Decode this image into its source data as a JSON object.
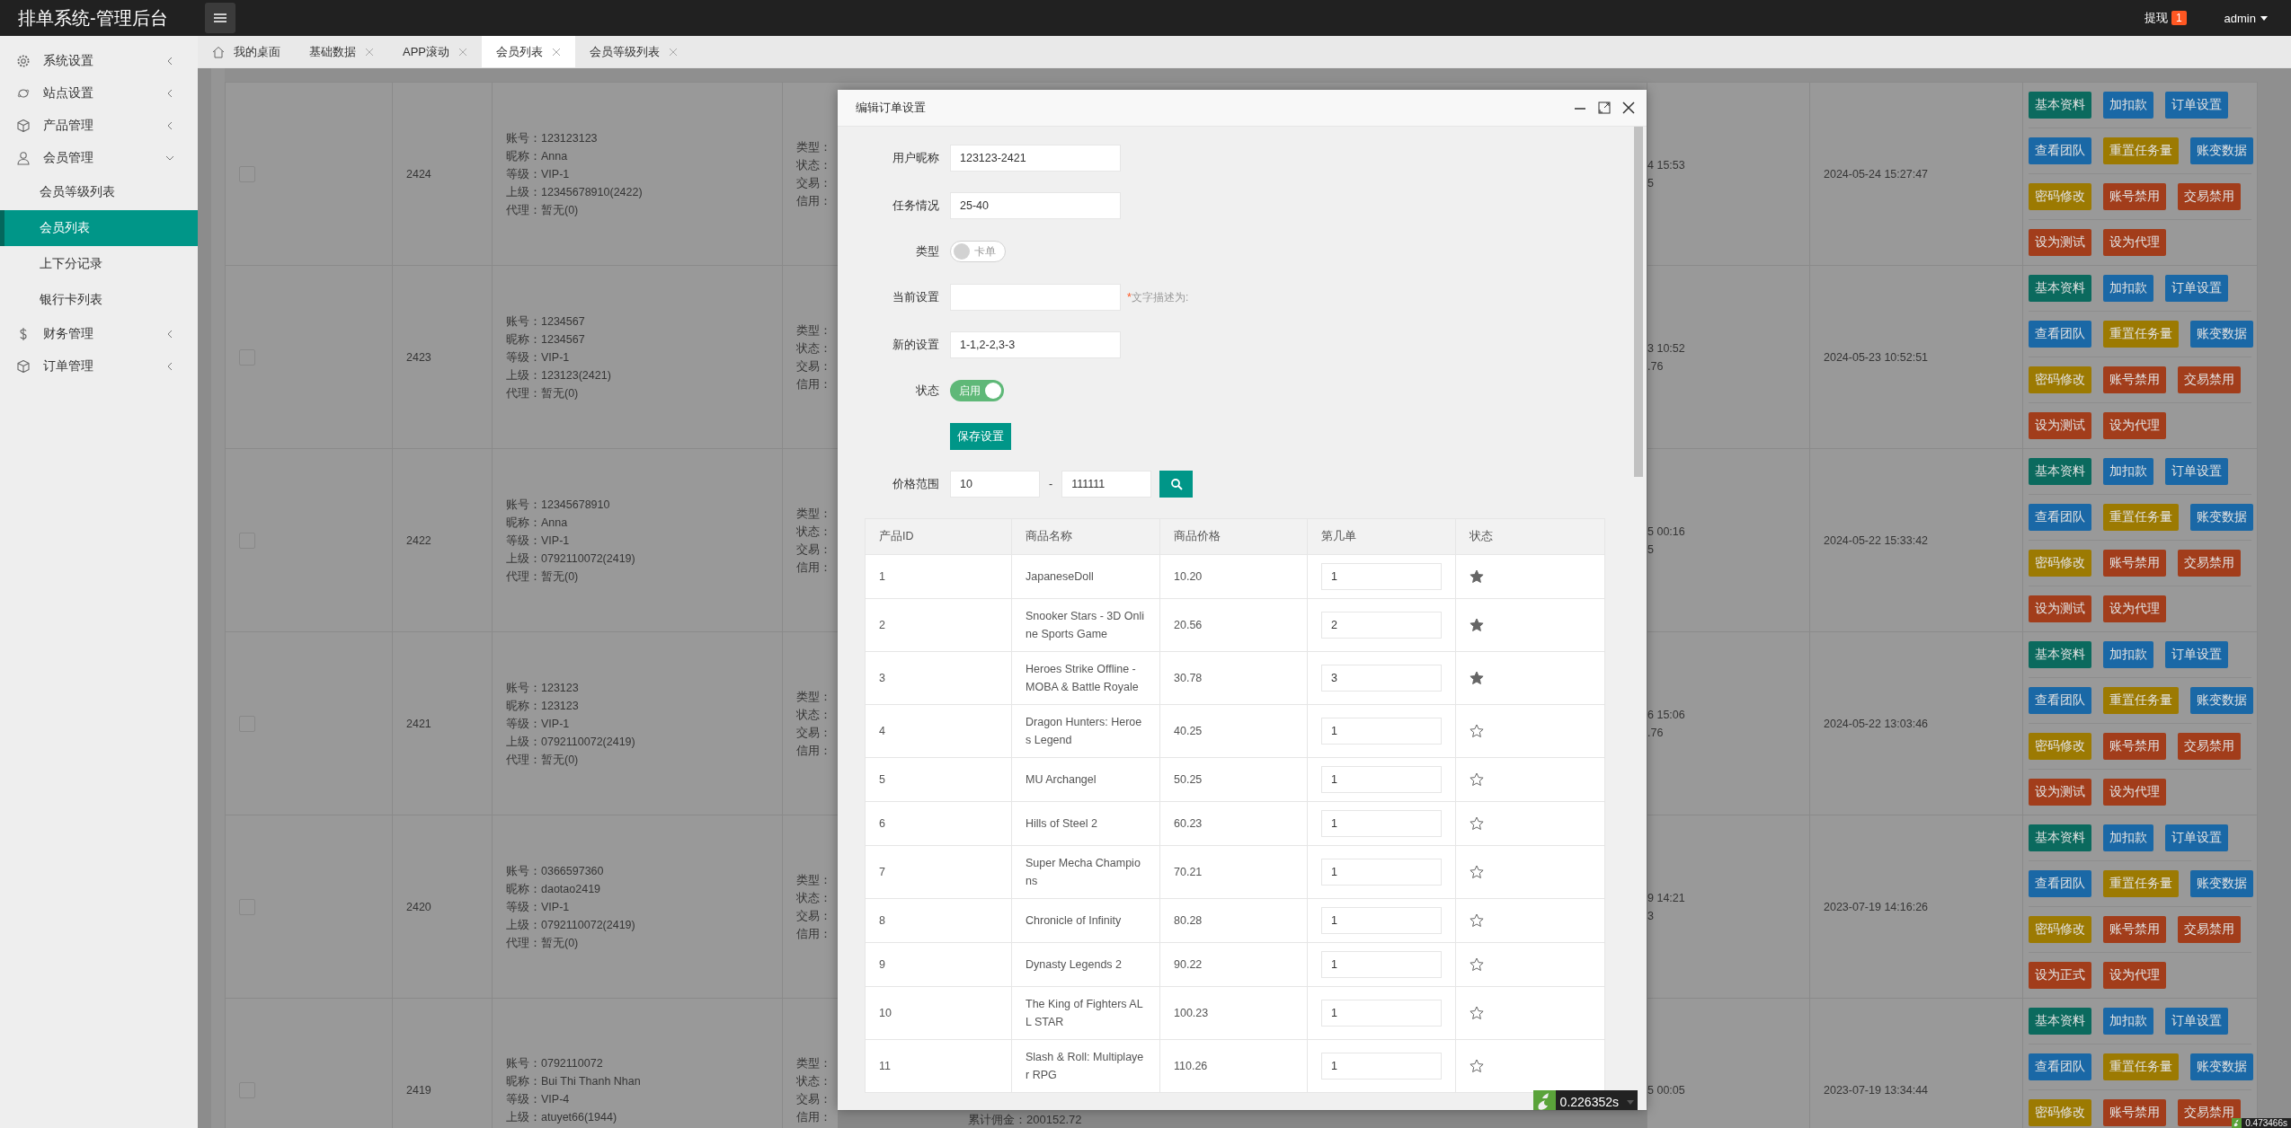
{
  "header": {
    "title": "排单系统-管理后台",
    "withdraw": "提现",
    "withdraw_count": "1",
    "user": "admin"
  },
  "sidebar": {
    "items": [
      {
        "label": "系统设置",
        "kind": "gear",
        "expanded": false
      },
      {
        "label": "站点设置",
        "kind": "site",
        "expanded": false
      },
      {
        "label": "产品管理",
        "kind": "cube",
        "expanded": false
      },
      {
        "label": "会员管理",
        "kind": "user",
        "expanded": true,
        "children": [
          {
            "label": "会员等级列表",
            "selected": false
          },
          {
            "label": "会员列表",
            "selected": true
          },
          {
            "label": "上下分记录",
            "selected": false
          },
          {
            "label": "银行卡列表",
            "selected": false
          }
        ]
      },
      {
        "label": "财务管理",
        "kind": "money",
        "expanded": false
      },
      {
        "label": "订单管理",
        "kind": "cube",
        "expanded": false
      }
    ]
  },
  "tabs": [
    {
      "label": "我的桌面",
      "kind": "home",
      "selected": false
    },
    {
      "label": "基础数据",
      "kind": "closable",
      "selected": false
    },
    {
      "label": "APP滚动",
      "kind": "closable",
      "selected": false
    },
    {
      "label": "会员列表",
      "kind": "closable",
      "selected": true
    },
    {
      "label": "会员等级列表",
      "kind": "closable",
      "selected": false
    }
  ],
  "members": {
    "rows": [
      {
        "checked": false,
        "id": "2424",
        "account": [
          "账号：123123123",
          "昵称：Anna",
          "等级：VIP-1",
          "上级：12345678910(2422)",
          "代理：暂无(0)"
        ],
        "profile": [
          "类型：",
          "状态：",
          "交易：",
          "信用："
        ],
        "times": [
          "4 15:53",
          "5"
        ],
        "date": "2024-05-24 15:27:47",
        "actions": [
          [
            {
              "label": "基本资料",
              "color": "#0b6a5e"
            },
            {
              "label": "加扣款",
              "color": "#1a68a6"
            },
            {
              "label": "订单设置",
              "color": "#1a68a6"
            }
          ],
          [
            {
              "label": "查看团队",
              "color": "#1a68a6"
            },
            {
              "label": "重置任务量",
              "color": "#9c7a02"
            },
            {
              "label": "账变数据",
              "color": "#1a68a6"
            }
          ],
          [
            {
              "label": "密码修改",
              "color": "#9c7a02"
            },
            {
              "label": "账号禁用",
              "color": "#a23d1b"
            },
            {
              "label": "交易禁用",
              "color": "#a23d1b"
            }
          ],
          [
            {
              "label": "设为测试",
              "color": "#a23d1b"
            },
            {
              "label": "设为代理",
              "color": "#a23d1b"
            }
          ]
        ]
      },
      {
        "checked": false,
        "id": "2423",
        "account": [
          "账号：1234567",
          "昵称：1234567",
          "等级：VIP-1",
          "上级：123123(2421)",
          "代理：暂无(0)"
        ],
        "profile": [
          "类型：",
          "状态：",
          "交易：",
          "信用："
        ],
        "times": [
          "3 10:52",
          ".76"
        ],
        "date": "2024-05-23 10:52:51",
        "actions": [
          [
            {
              "label": "基本资料",
              "color": "#0b6a5e"
            },
            {
              "label": "加扣款",
              "color": "#1a68a6"
            },
            {
              "label": "订单设置",
              "color": "#1a68a6"
            }
          ],
          [
            {
              "label": "查看团队",
              "color": "#1a68a6"
            },
            {
              "label": "重置任务量",
              "color": "#9c7a02"
            },
            {
              "label": "账变数据",
              "color": "#1a68a6"
            }
          ],
          [
            {
              "label": "密码修改",
              "color": "#9c7a02"
            },
            {
              "label": "账号禁用",
              "color": "#a23d1b"
            },
            {
              "label": "交易禁用",
              "color": "#a23d1b"
            }
          ],
          [
            {
              "label": "设为测试",
              "color": "#a23d1b"
            },
            {
              "label": "设为代理",
              "color": "#a23d1b"
            }
          ]
        ]
      },
      {
        "checked": false,
        "id": "2422",
        "account": [
          "账号：12345678910",
          "昵称：Anna",
          "等级：VIP-1",
          "上级：0792110072(2419)",
          "代理：暂无(0)"
        ],
        "profile": [
          "类型：",
          "状态：",
          "交易：",
          "信用："
        ],
        "times": [
          "5 00:16",
          "5"
        ],
        "date": "2024-05-22 15:33:42",
        "actions": [
          [
            {
              "label": "基本资料",
              "color": "#0b6a5e"
            },
            {
              "label": "加扣款",
              "color": "#1a68a6"
            },
            {
              "label": "订单设置",
              "color": "#1a68a6"
            }
          ],
          [
            {
              "label": "查看团队",
              "color": "#1a68a6"
            },
            {
              "label": "重置任务量",
              "color": "#9c7a02"
            },
            {
              "label": "账变数据",
              "color": "#1a68a6"
            }
          ],
          [
            {
              "label": "密码修改",
              "color": "#9c7a02"
            },
            {
              "label": "账号禁用",
              "color": "#a23d1b"
            },
            {
              "label": "交易禁用",
              "color": "#a23d1b"
            }
          ],
          [
            {
              "label": "设为测试",
              "color": "#a23d1b"
            },
            {
              "label": "设为代理",
              "color": "#a23d1b"
            }
          ]
        ]
      },
      {
        "checked": false,
        "id": "2421",
        "account": [
          "账号：123123",
          "昵称：123123",
          "等级：VIP-1",
          "上级：0792110072(2419)",
          "代理：暂无(0)"
        ],
        "profile": [
          "类型：",
          "状态：",
          "交易：",
          "信用："
        ],
        "times": [
          "6 15:06",
          ".76"
        ],
        "date": "2024-05-22 13:03:46",
        "actions": [
          [
            {
              "label": "基本资料",
              "color": "#0b6a5e"
            },
            {
              "label": "加扣款",
              "color": "#1a68a6"
            },
            {
              "label": "订单设置",
              "color": "#1a68a6"
            }
          ],
          [
            {
              "label": "查看团队",
              "color": "#1a68a6"
            },
            {
              "label": "重置任务量",
              "color": "#9c7a02"
            },
            {
              "label": "账变数据",
              "color": "#1a68a6"
            }
          ],
          [
            {
              "label": "密码修改",
              "color": "#9c7a02"
            },
            {
              "label": "账号禁用",
              "color": "#a23d1b"
            },
            {
              "label": "交易禁用",
              "color": "#a23d1b"
            }
          ],
          [
            {
              "label": "设为测试",
              "color": "#a23d1b"
            },
            {
              "label": "设为代理",
              "color": "#a23d1b"
            }
          ]
        ]
      },
      {
        "checked": false,
        "id": "2420",
        "account": [
          "账号：0366597360",
          "昵称：daotao2419",
          "等级：VIP-1",
          "上级：0792110072(2419)",
          "代理：暂无(0)"
        ],
        "profile": [
          "类型：",
          "状态：",
          "交易：",
          "信用："
        ],
        "times": [
          "9 14:21",
          "3"
        ],
        "date": "2023-07-19 14:16:26",
        "actions": [
          [
            {
              "label": "基本资料",
              "color": "#0b6a5e"
            },
            {
              "label": "加扣款",
              "color": "#1a68a6"
            },
            {
              "label": "订单设置",
              "color": "#1a68a6"
            }
          ],
          [
            {
              "label": "查看团队",
              "color": "#1a68a6"
            },
            {
              "label": "重置任务量",
              "color": "#9c7a02"
            },
            {
              "label": "账变数据",
              "color": "#1a68a6"
            }
          ],
          [
            {
              "label": "密码修改",
              "color": "#9c7a02"
            },
            {
              "label": "账号禁用",
              "color": "#a23d1b"
            },
            {
              "label": "交易禁用",
              "color": "#a23d1b"
            }
          ],
          [
            {
              "label": "设为正式",
              "color": "#a23d1b"
            },
            {
              "label": "设为代理",
              "color": "#a23d1b"
            }
          ]
        ]
      },
      {
        "checked": false,
        "id": "2419",
        "account": [
          "账号：0792110072",
          "昵称：Bui Thi Thanh Nhan",
          "等级：VIP-4",
          "上级：atuyet66(1944)"
        ],
        "profile": [
          "类型：",
          "状态：",
          "交易：",
          "信用："
        ],
        "times": [
          "5 00:05"
        ],
        "date": "2023-07-19 13:34:44",
        "actions": [
          [
            {
              "label": "基本资料",
              "color": "#0b6a5e"
            },
            {
              "label": "加扣款",
              "color": "#1a68a6"
            },
            {
              "label": "订单设置",
              "color": "#1a68a6"
            }
          ],
          [
            {
              "label": "查看团队",
              "color": "#1a68a6"
            },
            {
              "label": "重置任务量",
              "color": "#9c7a02"
            },
            {
              "label": "账变数据",
              "color": "#1a68a6"
            }
          ],
          [
            {
              "label": "密码修改",
              "color": "#9c7a02"
            },
            {
              "label": "账号禁用",
              "color": "#a23d1b"
            },
            {
              "label": "交易禁用",
              "color": "#a23d1b"
            }
          ]
        ]
      }
    ],
    "total": "累计佣金：200152.72",
    "timer": "0.473466s"
  },
  "modal": {
    "title": "编辑订单设置",
    "fields": [
      {
        "kind": "input",
        "label": "用户昵称",
        "value": "123123-2421"
      },
      {
        "kind": "input",
        "label": "任务情况",
        "value": "25-40"
      },
      {
        "kind": "switch",
        "label": "类型",
        "on": false,
        "text": "卡单"
      },
      {
        "kind": "input",
        "label": "当前设置",
        "mark": "*",
        "note": "文字描述为:"
      },
      {
        "kind": "input",
        "label": "新的设置",
        "value": "1-1,2-2,3-3"
      },
      {
        "kind": "switch",
        "label": "状态",
        "on": true,
        "text": "启用"
      },
      {
        "kind": "button",
        "label": "保存设置"
      },
      {
        "kind": "range",
        "label": "价格范围",
        "min": "10",
        "separator": "-",
        "max": "111111"
      }
    ],
    "products": {
      "columns": [
        "产品ID",
        "商品名称",
        "商品价格",
        "第几单",
        "状态"
      ],
      "rows": [
        {
          "id": "1",
          "name": "JapaneseDoll",
          "price": "10.20",
          "order": "1",
          "active": true
        },
        {
          "id": "2",
          "name": "Snooker Stars - 3D Online Sports Game",
          "price": "20.56",
          "order": "2",
          "active": true
        },
        {
          "id": "3",
          "name": "Heroes Strike Offline - MOBA & Battle Royale",
          "price": "30.78",
          "order": "3",
          "active": true
        },
        {
          "id": "4",
          "name": "Dragon Hunters: Heroes Legend",
          "price": "40.25",
          "order": "1",
          "active": false
        },
        {
          "id": "5",
          "name": "MU Archangel",
          "price": "50.25",
          "order": "1",
          "active": false
        },
        {
          "id": "6",
          "name": "Hills of Steel 2",
          "price": "60.23",
          "order": "1",
          "active": false
        },
        {
          "id": "7",
          "name": "Super Mecha Champions",
          "price": "70.21",
          "order": "1",
          "active": false
        },
        {
          "id": "8",
          "name": "Chronicle of Infinity",
          "price": "80.28",
          "order": "1",
          "active": false
        },
        {
          "id": "9",
          "name": "Dynasty Legends 2",
          "price": "90.22",
          "order": "1",
          "active": false
        },
        {
          "id": "10",
          "name": "The King of Fighters ALL STAR",
          "price": "100.23",
          "order": "1",
          "active": false
        },
        {
          "id": "11",
          "name": "Slash & Roll: Multiplayer RPG",
          "price": "110.26",
          "order": "1",
          "active": false
        }
      ]
    },
    "timer": "0.226352s"
  }
}
